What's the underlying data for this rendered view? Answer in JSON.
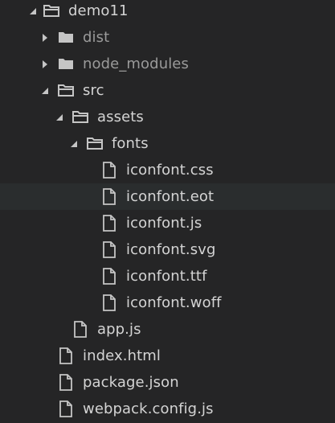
{
  "explorer": {
    "root": {
      "label": "demo11",
      "expanded": true,
      "icon": "folder-open-icon"
    },
    "items": [
      {
        "label": "dist",
        "type": "folder",
        "expanded": false,
        "dimmed": true
      },
      {
        "label": "node_modules",
        "type": "folder",
        "expanded": false,
        "dimmed": true
      },
      {
        "label": "src",
        "type": "folder",
        "expanded": true
      },
      {
        "label": "assets",
        "type": "folder",
        "expanded": true
      },
      {
        "label": "fonts",
        "type": "folder",
        "expanded": true
      },
      {
        "label": "iconfont.css",
        "type": "file"
      },
      {
        "label": "iconfont.eot",
        "type": "file",
        "hovered": true
      },
      {
        "label": "iconfont.js",
        "type": "file"
      },
      {
        "label": "iconfont.svg",
        "type": "file"
      },
      {
        "label": "iconfont.ttf",
        "type": "file"
      },
      {
        "label": "iconfont.woff",
        "type": "file"
      },
      {
        "label": "app.js",
        "type": "file"
      },
      {
        "label": "index.html",
        "type": "file"
      },
      {
        "label": "package.json",
        "type": "file"
      },
      {
        "label": "webpack.config.js",
        "type": "file"
      }
    ]
  },
  "colors": {
    "background": "#252526",
    "hover_row": "#2a2d2e",
    "text": "#d4d4d4",
    "dim_text": "#9a9a9a",
    "icon": "#c5c5c5"
  }
}
